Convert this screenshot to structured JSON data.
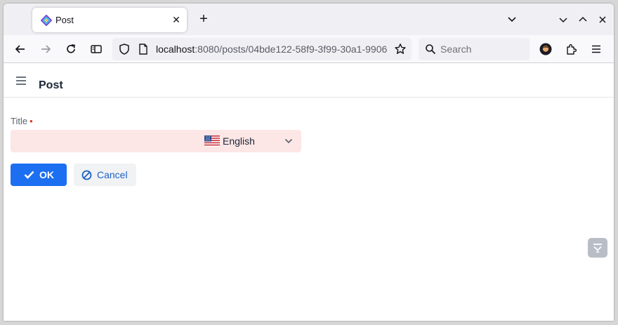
{
  "browser": {
    "tab": {
      "title": "Post",
      "favicon": "jmix-logo-icon"
    },
    "url": {
      "host": "localhost",
      "rest": ":8080/posts/04bde122-58f9-3f99-30a1-9906"
    },
    "search": {
      "placeholder": "Search"
    }
  },
  "app": {
    "header": {
      "title": "Post",
      "menu_icon": "menu-icon"
    },
    "form": {
      "title_label": "Title",
      "required_marker": "•",
      "title_value": "",
      "language": {
        "selected": "English",
        "flag": "us-flag-icon"
      }
    },
    "actions": {
      "ok_label": "OK",
      "cancel_label": "Cancel"
    }
  },
  "colors": {
    "primary": "#1c6ff0",
    "invalid_field_bg": "#fde6e6",
    "required": "#e0301e",
    "cancel_text": "#1d62c6"
  }
}
